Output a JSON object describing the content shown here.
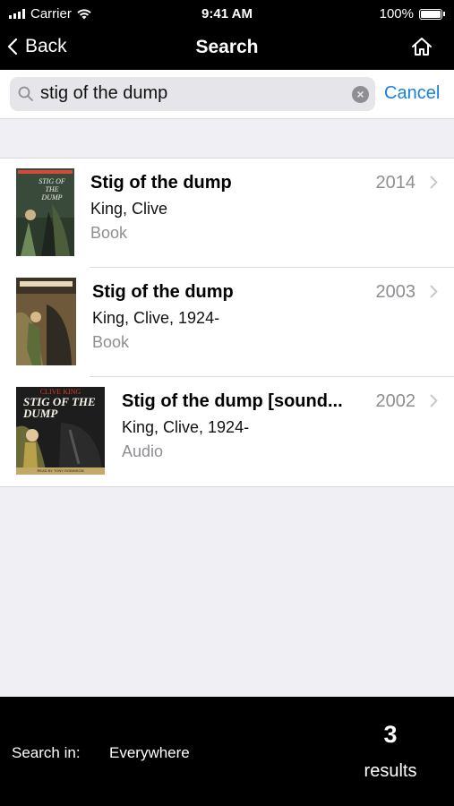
{
  "status_bar": {
    "carrier": "Carrier",
    "time": "9:41 AM",
    "battery": "100%"
  },
  "nav": {
    "back_label": "Back",
    "title": "Search",
    "home_icon": "home-icon"
  },
  "search": {
    "query": "stig of the dump",
    "cancel_label": "Cancel"
  },
  "results": [
    {
      "title": "Stig of the dump",
      "author": "King, Clive",
      "type": "Book",
      "year": "2014"
    },
    {
      "title": "Stig of the dump",
      "author": "King, Clive, 1924-",
      "type": "Book",
      "year": "2003"
    },
    {
      "title": "Stig of the dump [sound...",
      "author": "King, Clive, 1924-",
      "type": "Audio",
      "year": "2002"
    }
  ],
  "covers": [
    {
      "top_text": "",
      "title_text": "STIG OF THE DUMP",
      "bottom_text": ""
    },
    {
      "top_text": "",
      "title_text": "",
      "bottom_text": ""
    },
    {
      "top_text": "CLIVE KING",
      "title_text": "STIG OF THE DUMP",
      "bottom_text": "READ BY TONY ROBINSON"
    }
  ],
  "bottom_bar": {
    "search_in_label": "Search in:",
    "scope": "Everywhere",
    "count": "3",
    "results_label": "results"
  },
  "colors": {
    "accent": "#1a7fe0",
    "bar_background": "#000000",
    "page_background": "#efeff4"
  }
}
